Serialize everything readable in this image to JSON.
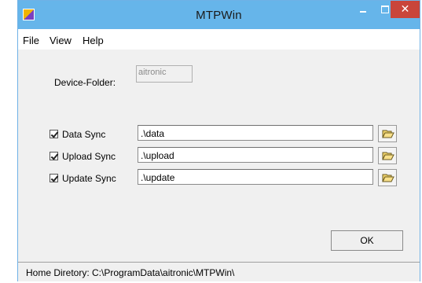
{
  "window": {
    "title": "MTPWin",
    "close_glyph": "✕"
  },
  "menu": {
    "items": [
      "File",
      "View",
      "Help"
    ]
  },
  "device_folder": {
    "label": "Device-Folder:",
    "value": "aitronic"
  },
  "sync_rows": [
    {
      "label": "Data Sync",
      "path": ".\\data",
      "checked": true
    },
    {
      "label": "Upload Sync",
      "path": ".\\upload",
      "checked": true
    },
    {
      "label": "Update Sync",
      "path": ".\\update",
      "checked": true
    }
  ],
  "ok_button": {
    "label": "OK"
  },
  "statusbar": {
    "text": "Home Diretory: C:\\ProgramData\\aitronic\\MTPWin\\"
  },
  "icons": {
    "app": "app-icon",
    "folder": "folder-open-icon"
  },
  "colors": {
    "titlebar": "#66b5ea",
    "close": "#c9453a",
    "window_bg": "#f0f0f0"
  }
}
